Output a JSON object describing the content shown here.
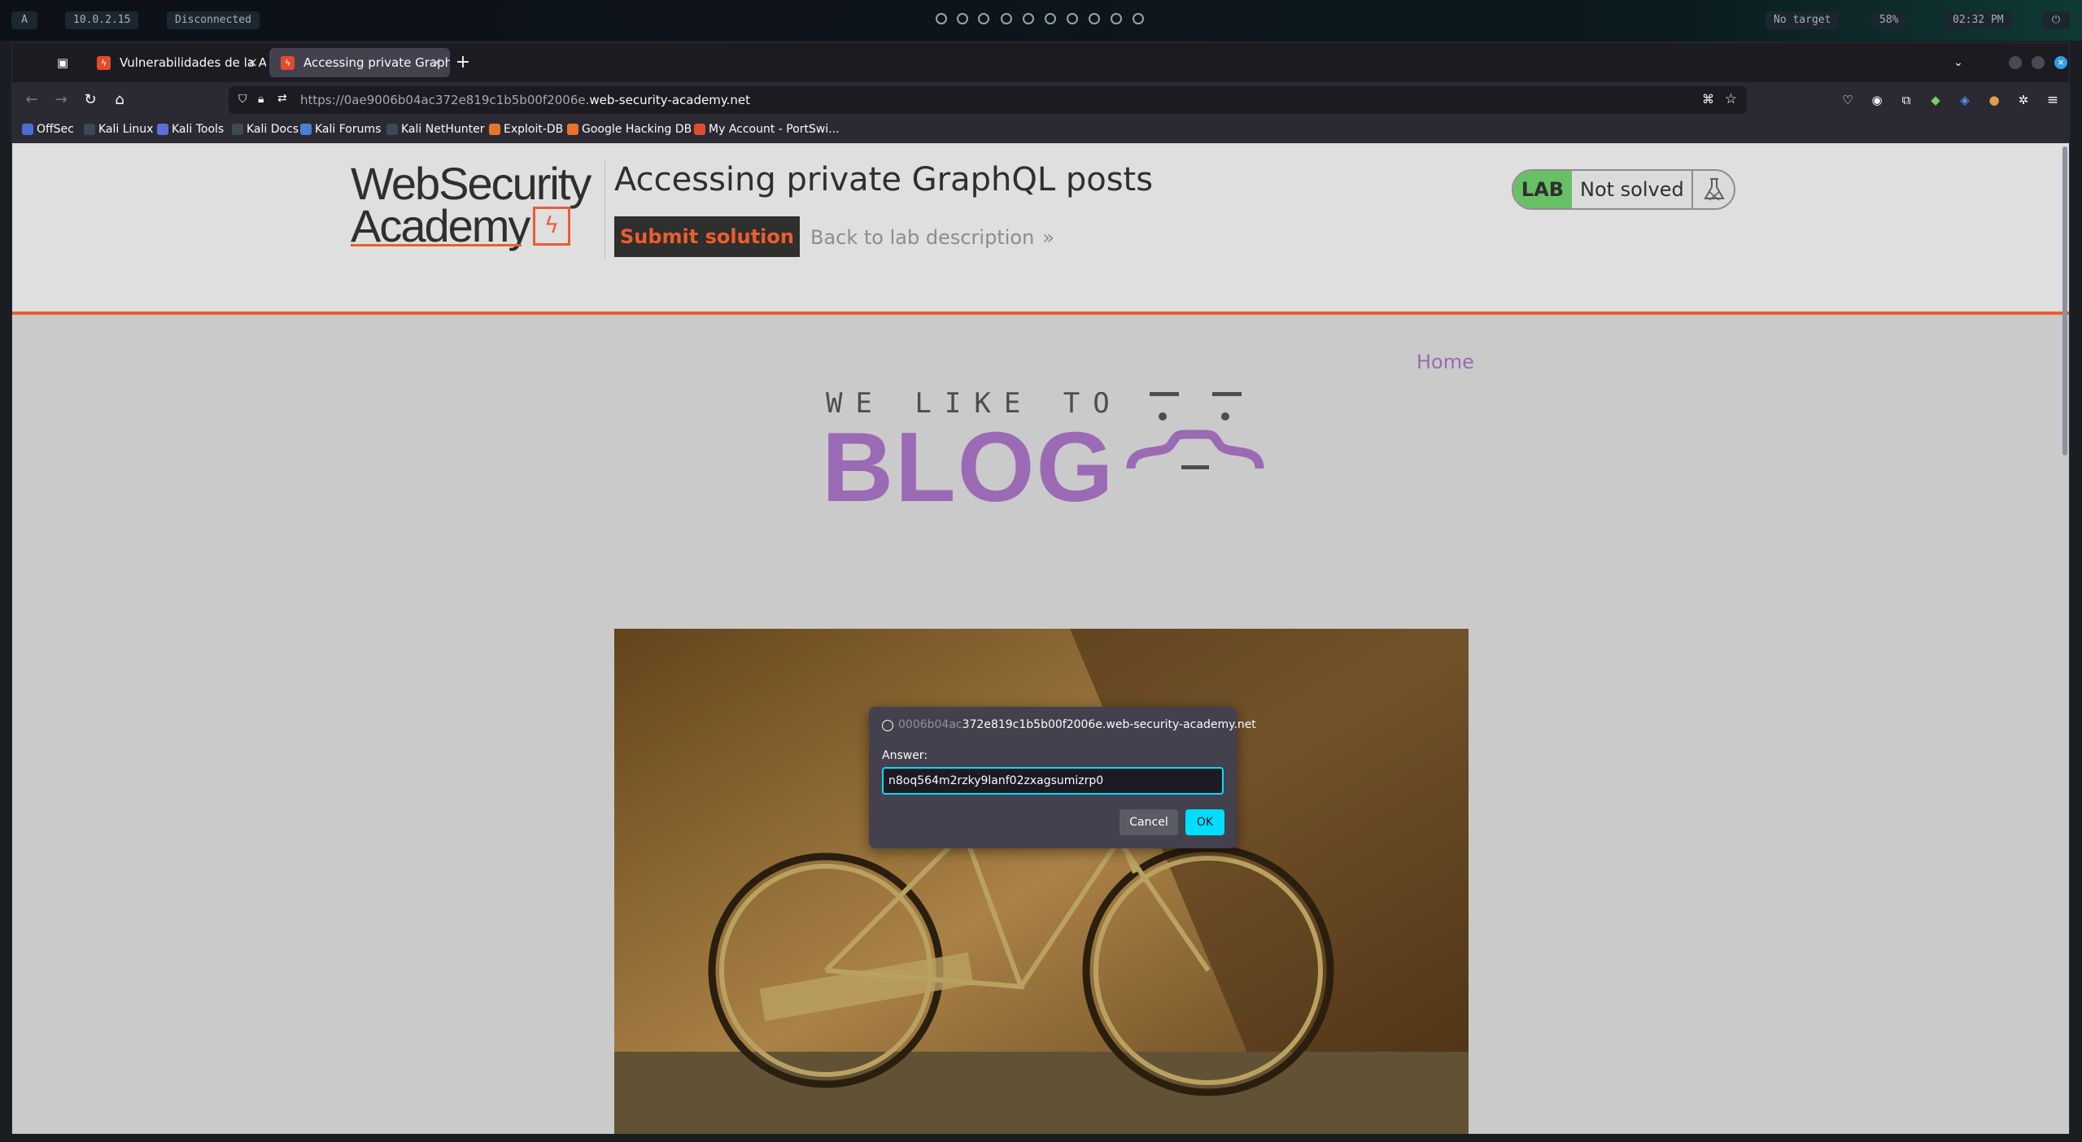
{
  "panel": {
    "logo": "A",
    "ip": "10.0.2.15",
    "vpn": "Disconnected",
    "target": "No target",
    "volume": "58%",
    "clock": "02:32 PM"
  },
  "browser": {
    "tabs": [
      {
        "label": "Vulnerabilidades de la API"
      },
      {
        "label": "Accessing private GraphQL"
      }
    ],
    "new_tab": "+",
    "url_prefix": "https://0ae9006b04ac372e819c1b5b00f2006e.",
    "url_domain": "web-security-academy.net",
    "bookmarks": [
      "OffSec",
      "Kali Linux",
      "Kali Tools",
      "Kali Docs",
      "Kali Forums",
      "Kali NetHunter",
      "Exploit-DB",
      "Google Hacking DB",
      "My Account - PortSwi..."
    ]
  },
  "lab": {
    "logo_line1": "WebSecurity",
    "logo_line2": "Academy",
    "title": "Accessing private GraphQL posts",
    "submit": "Submit solution",
    "back": "Back to lab description",
    "back_arrow": "»",
    "badge": "LAB",
    "status": "Not solved"
  },
  "blog": {
    "nav_home": "Home",
    "tagline": "WE LIKE TO",
    "brand": "BLOG"
  },
  "dialog": {
    "origin_faded": "0006b04ac",
    "origin_main": "372e819c1b5b00f2006e.web-security-academy.net",
    "label": "Answer:",
    "value": "n8oq564m2rzky9lanf02zxagsumizrp0",
    "cancel": "Cancel",
    "ok": "OK"
  },
  "colors": {
    "accent_orange": "#ff6633",
    "blog_purple": "#a974c4",
    "lab_green": "#70d16d",
    "dialog_ok": "#00ddff"
  }
}
